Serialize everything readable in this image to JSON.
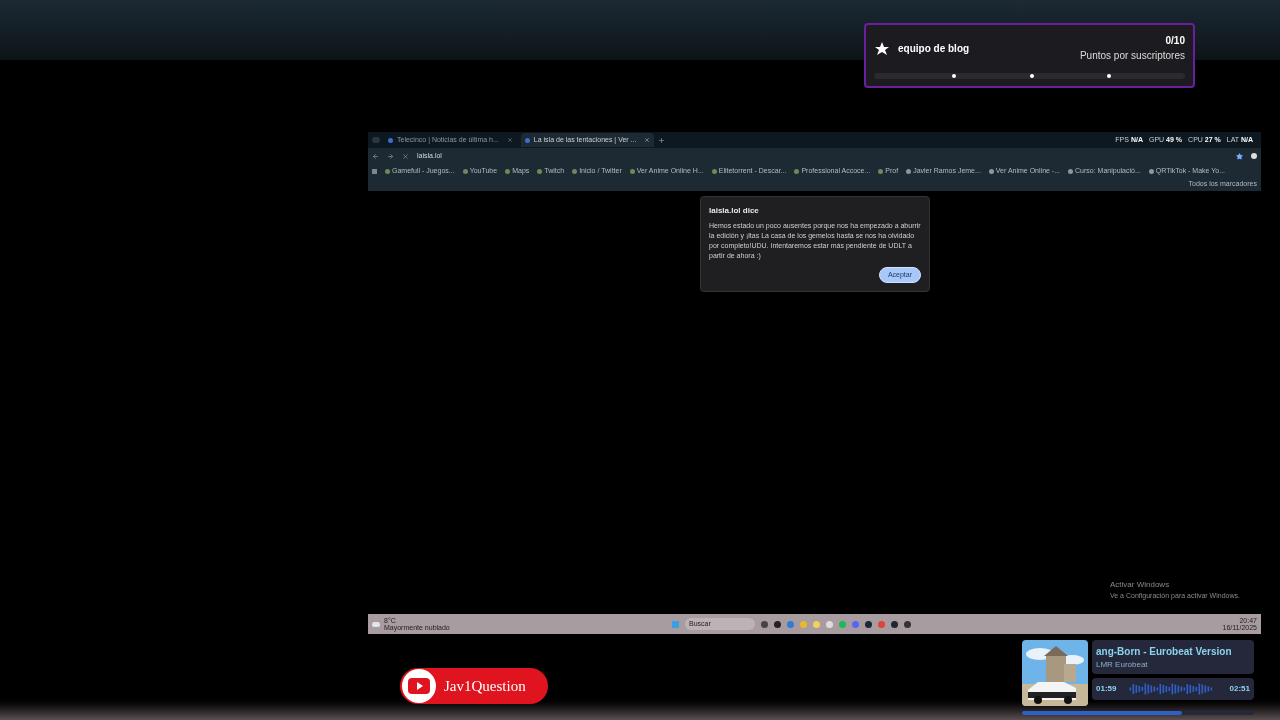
{
  "browser": {
    "tabs": [
      {
        "label": "Telecinco | Noticias de última h...",
        "selected": false
      },
      {
        "label": "La isla de las tentaciones | Ver ...",
        "selected": true
      }
    ],
    "address": "laisla.lol",
    "bookmarks": [
      "Gamefull - Juegos...",
      "YouTube",
      "Maps",
      "Twitch",
      "Inicio / Twitter",
      "Ver Anime Online H...",
      "Elitetorrent - Descar...",
      "Professional Accoce...",
      "Prof"
    ],
    "bookmarks_right": [
      "Javier Ramos Jeme...",
      "Ver Anime Online -...",
      "Curso: Manipulació...",
      "QRTikTok - Make Yo..."
    ],
    "all_bookmarks": "Todos los marcadores"
  },
  "perf_overlay": [
    {
      "label": "FPS",
      "value": "N/A"
    },
    {
      "label": "GPU",
      "value": "49 %"
    },
    {
      "label": "CPU",
      "value": "27 %"
    },
    {
      "label": "LAT",
      "value": "N/A"
    }
  ],
  "dialog": {
    "title": "laisla.lol dice",
    "message": "Hemos estado un poco ausentes porque nos ha empezado a aburrir la edición y ¡ltas La casa de los gemelos hasta se nos ha olvidado por completo!UDU. Intentaremos estar más pendiente de UDLT a partir de ahora :)",
    "button": "Aceptar"
  },
  "taskbar": {
    "weather_temp": "8°C",
    "weather_text": "Mayormente nublado",
    "search": "Buscar",
    "time": "20:47",
    "date": "16/11/2025"
  },
  "watermark_windows": {
    "title": "Activar Windows",
    "text": "Ve a Configuración para activar Windows."
  },
  "goal_widget": {
    "title": "equipo de blog",
    "count": "0/10",
    "subtitle": "Puntos por suscriptores"
  },
  "channel_badge": {
    "name": "Jav1Question"
  },
  "now_playing": {
    "title": "ang-Born - Eurobeat Version",
    "artist": "LMR Eurobeat",
    "elapsed": "01:59",
    "total": "02:51",
    "level": 0.69
  }
}
